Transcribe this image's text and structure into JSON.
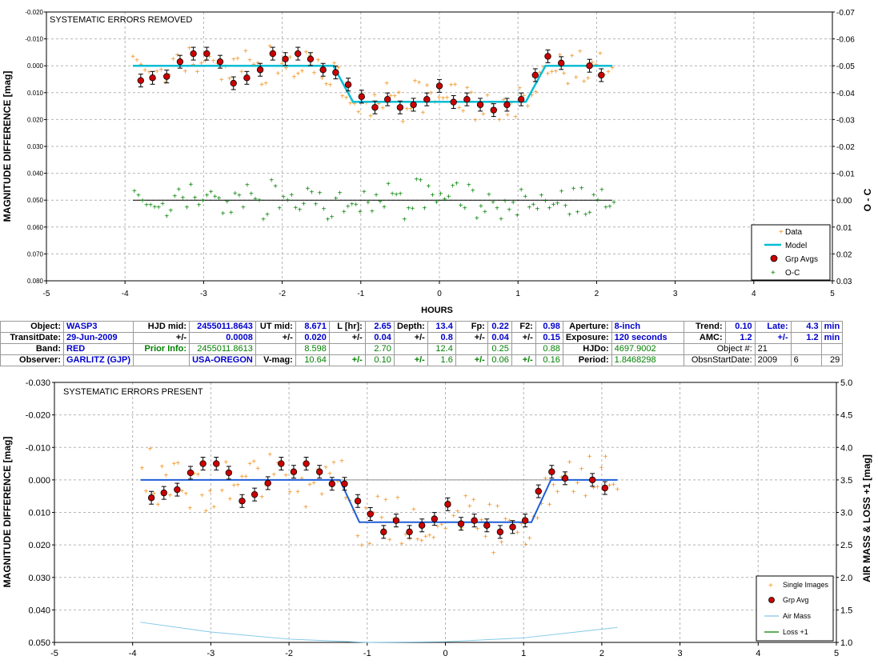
{
  "top_chart": {
    "annotation": "SYSTEMATIC ERRORS REMOVED",
    "ylabel": "MAGNITUDE DIFFERENCE [mag]",
    "y2label": "O - C",
    "xlabel": "HOURS",
    "legend": [
      "Data",
      "Model",
      "Grp Avgs",
      "O-C"
    ]
  },
  "bottom_chart": {
    "annotation": "SYSTEMATIC ERRORS PRESENT",
    "ylabel": "MAGNITUDE DIFFERENCE [mag]",
    "y2label": "AIR MASS & LOSS +1 [mag]",
    "legend": [
      "Single Images",
      "Grp Avg",
      "Air Mass",
      "Loss +1"
    ]
  },
  "info": {
    "r1": [
      "Object:",
      "WASP3",
      "HJD mid:",
      "2455011.8643",
      "UT mid:",
      "8.671",
      "L [hr]:",
      "2.65",
      "Depth:",
      "13.4",
      "Fp:",
      "0.22",
      "F2:",
      "0.98",
      "Aperture:",
      "8-inch",
      "Trend:",
      "0.10",
      "Late:",
      "4.3",
      "min"
    ],
    "r2": [
      "TransitDate:",
      "29-Jun-2009",
      "+/-",
      "0.0008",
      "+/-",
      "0.020",
      "+/-",
      "0.04",
      "+/-",
      "0.8",
      "+/-",
      "0.04",
      "+/-",
      "0.15",
      "Exposure:",
      "120 seconds",
      "AMC:",
      "1.2",
      "+/-",
      "1.2",
      "min"
    ],
    "r3": [
      "Band:",
      "RED",
      "Prior Info:",
      "2455011.8613",
      "8.598",
      "2.70",
      "12.4",
      "0.25",
      "0.88",
      "HJDo:",
      "4697.9002",
      "Object #:",
      "21"
    ],
    "r4": [
      "Observer:",
      "GARLITZ (GJP)",
      "USA-OREGON",
      "V-mag:",
      "10.64",
      "+/-",
      "0.10",
      "+/-",
      "1.6",
      "+/-",
      "0.06",
      "+/-",
      "0.16",
      "Period:",
      "1.8468298",
      "ObsnStartDate:",
      "2009",
      "6",
      "29"
    ]
  },
  "chart_data": [
    {
      "type": "scatter",
      "title": "SYSTEMATIC ERRORS REMOVED",
      "xlabel": "HOURS",
      "ylabel": "MAGNITUDE DIFFERENCE [mag]",
      "y2label": "O - C",
      "xlim": [
        -5,
        5
      ],
      "ylim": [
        -0.02,
        0.08
      ],
      "y_inverted": true,
      "y2lim": [
        -0.07,
        0.03
      ],
      "y2_inverted": true,
      "x_ticks": [
        -5,
        -4,
        -3,
        -2,
        -1,
        0,
        1,
        2,
        3,
        4,
        5
      ],
      "y_ticks": [
        "-0.020",
        "-0.010",
        "0.000",
        "0.010",
        "0.020",
        "0.030",
        "0.040",
        "0.050",
        "0.060",
        "0.070",
        "0.080"
      ],
      "y2_ticks": [
        "-0.07",
        "-0.06",
        "-0.05",
        "-0.04",
        "-0.03",
        "-0.02",
        "-0.01",
        "0.00",
        "0.01",
        "0.02",
        "0.03"
      ],
      "grid": true,
      "legend_position": "bottom-right",
      "series": [
        {
          "name": "Model",
          "color": "#00bcd4",
          "x": [
            -3.9,
            -1.35,
            -1.1,
            1.1,
            1.35,
            2.2
          ],
          "y": [
            0.0,
            0.0,
            0.0134,
            0.0134,
            0.0,
            0.0
          ]
        },
        {
          "name": "Grp Avgs",
          "color": "#cc0000",
          "x": [
            -3.8,
            -3.65,
            -3.47,
            -3.3,
            -3.13,
            -2.96,
            -2.79,
            -2.62,
            -2.45,
            -2.28,
            -2.12,
            -1.96,
            -1.8,
            -1.64,
            -1.48,
            -1.32,
            -1.16,
            -0.99,
            -0.82,
            -0.66,
            -0.5,
            -0.33,
            -0.16,
            0.0,
            0.18,
            0.35,
            0.52,
            0.69,
            0.86,
            1.04,
            1.22,
            1.38,
            1.55,
            1.91,
            2.06
          ],
          "y": [
            0.0055,
            0.0045,
            0.004,
            -0.0015,
            -0.0045,
            -0.0045,
            -0.0015,
            0.0065,
            0.0045,
            0.0015,
            -0.0045,
            -0.0025,
            -0.0045,
            -0.0025,
            0.0015,
            0.0025,
            0.007,
            0.0115,
            0.0155,
            0.0125,
            0.0155,
            0.0145,
            0.0125,
            0.0075,
            0.0135,
            0.0125,
            0.0145,
            0.0165,
            0.0145,
            0.0125,
            0.0035,
            -0.0035,
            -0.001,
            0.0,
            0.0035
          ]
        },
        {
          "name": "O-C",
          "color": "#008000",
          "baseline": 0.0
        }
      ]
    },
    {
      "type": "scatter",
      "title": "SYSTEMATIC ERRORS PRESENT",
      "ylabel": "MAGNITUDE DIFFERENCE [mag]",
      "y2label": "AIR MASS & LOSS +1 [mag]",
      "xlim": [
        -5,
        5
      ],
      "ylim": [
        -0.03,
        0.05
      ],
      "y_inverted": true,
      "y2lim": [
        1.0,
        5.0
      ],
      "x_ticks": [
        -5,
        -4,
        -3,
        -2,
        -1,
        0,
        1,
        2,
        3,
        4,
        5
      ],
      "y_ticks": [
        "-0.030",
        "-0.020",
        "-0.010",
        "0.000",
        "0.010",
        "0.020",
        "0.030",
        "0.040",
        "0.050"
      ],
      "y2_ticks": [
        "5.0",
        "4.5",
        "4.0",
        "3.5",
        "3.0",
        "2.5",
        "2.0",
        "1.5",
        "1.0"
      ],
      "grid": true,
      "legend_position": "bottom-right",
      "series": [
        {
          "name": "Grp Avg",
          "color": "#cc0000",
          "x": [
            -3.76,
            -3.6,
            -3.43,
            -3.26,
            -3.1,
            -2.93,
            -2.77,
            -2.6,
            -2.44,
            -2.27,
            -2.1,
            -1.94,
            -1.78,
            -1.61,
            -1.45,
            -1.29,
            -1.12,
            -0.96,
            -0.79,
            -0.63,
            -0.46,
            -0.3,
            -0.14,
            0.03,
            0.2,
            0.37,
            0.53,
            0.7,
            0.86,
            1.02,
            1.19,
            1.36,
            1.53,
            1.88,
            2.04
          ],
          "y": [
            0.0055,
            0.004,
            0.003,
            -0.0022,
            -0.005,
            -0.005,
            -0.0022,
            0.0065,
            0.0045,
            0.001,
            -0.005,
            -0.0025,
            -0.005,
            -0.0025,
            0.0012,
            0.0012,
            0.0065,
            0.0105,
            0.016,
            0.0125,
            0.016,
            0.014,
            0.012,
            0.0075,
            0.0135,
            0.0125,
            0.014,
            0.016,
            0.0145,
            0.0125,
            0.0035,
            -0.0025,
            -0.0005,
            0.0,
            0.0025
          ]
        },
        {
          "name": "Model",
          "color": "#1f5fd6",
          "x": [
            -3.9,
            -1.35,
            -1.1,
            1.1,
            1.35,
            2.2
          ],
          "y": [
            0.0,
            0.0,
            0.013,
            0.013,
            0.0,
            0.0
          ]
        },
        {
          "name": "Air Mass",
          "color": "#80c8e8",
          "axis": "y2",
          "x": [
            -3.9,
            -3.0,
            -2.0,
            -1.0,
            0.0,
            1.0,
            2.2
          ],
          "y": [
            1.31,
            1.16,
            1.05,
            1.0,
            1.01,
            1.07,
            1.23
          ]
        },
        {
          "name": "Loss +1",
          "color": "#008000",
          "axis": "y2"
        }
      ]
    }
  ],
  "colors": {
    "data": "#f0901a",
    "model_top": "#00bcd4",
    "model_bottom": "#1f5fd6",
    "grp_avg": "#cc0000",
    "oc": "#008000",
    "airmass": "#80c8e8"
  }
}
